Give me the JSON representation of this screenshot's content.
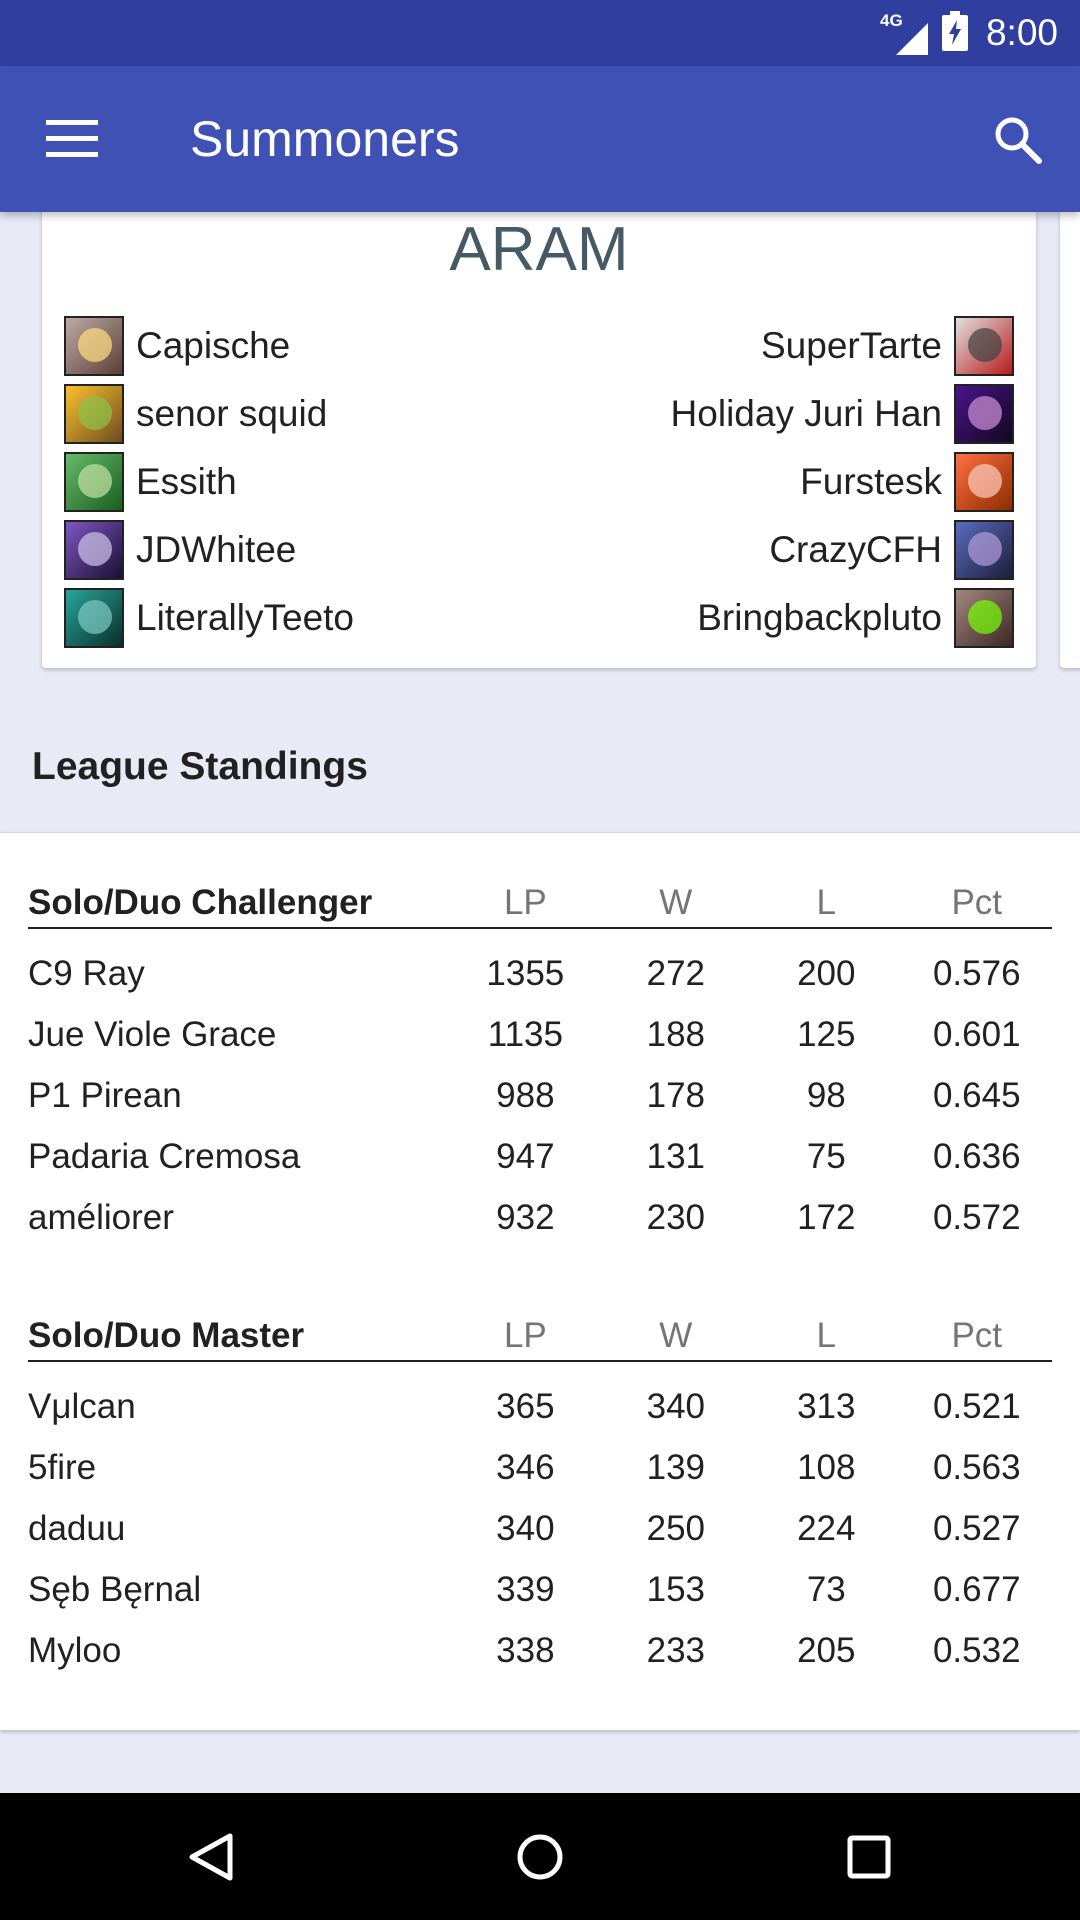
{
  "status_bar": {
    "network": "4G",
    "time": "8:00"
  },
  "app_bar": {
    "title": "Summoners"
  },
  "aram": {
    "title": "ARAM",
    "team_left": [
      {
        "name": "Capische",
        "color": "#8d6e63"
      },
      {
        "name": "senor squid",
        "color": "#c9a227"
      },
      {
        "name": "Essith",
        "color": "#4caf50"
      },
      {
        "name": "JDWhitee",
        "color": "#5e4b8b"
      },
      {
        "name": "LiterallyTeeto",
        "color": "#1e8c7a"
      }
    ],
    "team_right": [
      {
        "name": "SuperTarte",
        "color": "#b71c1c"
      },
      {
        "name": "Holiday Juri Han",
        "color": "#6a3fa0"
      },
      {
        "name": "Furstesk",
        "color": "#e65100"
      },
      {
        "name": "CrazyCFH",
        "color": "#3a3f7a"
      },
      {
        "name": "Bringbackpluto",
        "color": "#7a5b2b"
      }
    ]
  },
  "standings": {
    "heading": "League Standings",
    "tiers": [
      {
        "name": "Solo/Duo Challenger",
        "columns": [
          "LP",
          "W",
          "L",
          "Pct"
        ],
        "rows": [
          [
            "C9 Ray",
            "1355",
            "272",
            "200",
            "0.576"
          ],
          [
            "Jue Viole Grace",
            "1135",
            "188",
            "125",
            "0.601"
          ],
          [
            "P1 Pirean",
            "988",
            "178",
            "98",
            "0.645"
          ],
          [
            "Padaria Cremosa",
            "947",
            "131",
            "75",
            "0.636"
          ],
          [
            "améliorer",
            "932",
            "230",
            "172",
            "0.572"
          ]
        ]
      },
      {
        "name": "Solo/Duo Master",
        "columns": [
          "LP",
          "W",
          "L",
          "Pct"
        ],
        "rows": [
          [
            "Vμlcan",
            "365",
            "340",
            "313",
            "0.521"
          ],
          [
            "5fire",
            "346",
            "139",
            "108",
            "0.563"
          ],
          [
            "daduu",
            "340",
            "250",
            "224",
            "0.527"
          ],
          [
            "Sęb Bęrnal",
            "339",
            "153",
            "73",
            "0.677"
          ],
          [
            "Myloo",
            "338",
            "233",
            "205",
            "0.532"
          ]
        ]
      }
    ]
  },
  "colors": {
    "status_bar": "#303f9f",
    "app_bar": "#3f51b5",
    "background": "#e8eaf6"
  }
}
